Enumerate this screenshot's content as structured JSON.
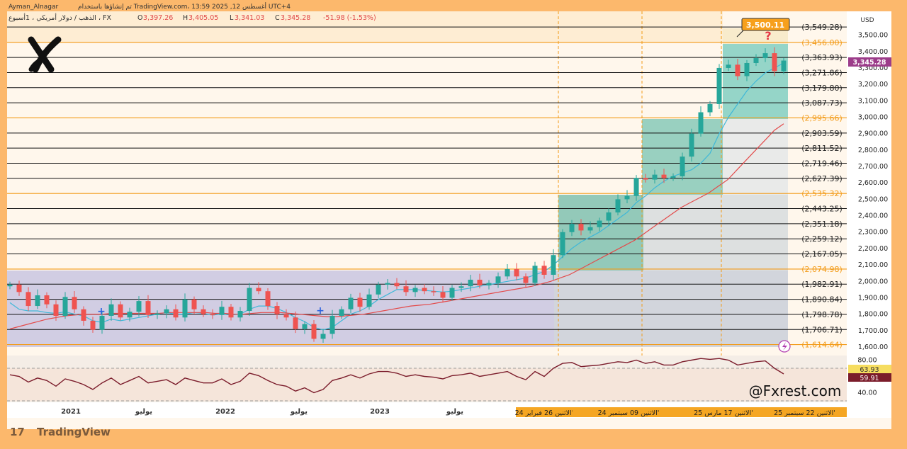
{
  "header": {
    "author": "Ayman_Alnagar",
    "published": "تم إنشاؤها باستخدام TradingView.com، 13:59 2025 ,12 أغسطس UTC+4",
    "symbol": "الذهب / دولار أمريكي ، 1أسبوع ، FX",
    "ohlc": {
      "O": "3,397.26",
      "H": "3,405.05",
      "L": "3,341.03",
      "C": "3,345.28",
      "chg": "-51.98 (-1.53%)"
    }
  },
  "watermark": "@Fxrest.com",
  "footer_brand": "TradingView",
  "currency": "USD",
  "last_price": "3,345.28",
  "callout": {
    "value": "3,500.11",
    "mark": "?"
  },
  "colors": {
    "background": "#fcb86c",
    "up": "#26a69a",
    "down": "#ef5350",
    "ma_fast": "#3fb8d8",
    "ma_slow": "#e34b4b",
    "rsi": "#7b1c2b",
    "fib_orange": "#f39a16",
    "callout": "#f7a01c"
  },
  "chart_data": [
    {
      "type": "line",
      "title": "",
      "ylabel": "USD",
      "ylim": [
        1600,
        3600
      ],
      "y_ticks": [
        "3,500.00",
        "3,400.00",
        "3,300.00",
        "3,200.00",
        "3,100.00",
        "3,000.00",
        "2,900.00",
        "2,800.00",
        "2,700.00",
        "2,600.00",
        "2,500.00",
        "2,400.00",
        "2,300.00",
        "2,200.00",
        "2,100.00",
        "2,000.00",
        "1,900.00",
        "1,800.00",
        "1,700.00",
        "1,600.00"
      ],
      "x_ticks": [
        "2021",
        "يوليو",
        "2022",
        "يوليو",
        "2023",
        "يوليو"
      ],
      "date_labels": [
        "الاثنين 26 فبراير 24'",
        "الاثنين 09 سبتمبر 24'",
        "الاثنين 17 مارس 25'",
        "الاثنين 22 سبتمبر 25'"
      ],
      "grid": false,
      "levels": [
        {
          "label": "(3,549.28)",
          "value": 3549.28,
          "color": "black"
        },
        {
          "label": "(3,456.00)",
          "value": 3456.0,
          "color": "orange"
        },
        {
          "label": "(3,363.93)",
          "value": 3363.93,
          "color": "black"
        },
        {
          "label": "(3,271.86)",
          "value": 3271.86,
          "color": "black"
        },
        {
          "label": "(3,179.80)",
          "value": 3179.8,
          "color": "black"
        },
        {
          "label": "(3,087.73)",
          "value": 3087.73,
          "color": "black"
        },
        {
          "label": "(2,995.66)",
          "value": 2995.66,
          "color": "orange"
        },
        {
          "label": "(2,903.59)",
          "value": 2903.59,
          "color": "black"
        },
        {
          "label": "(2,811.52)",
          "value": 2811.52,
          "color": "black"
        },
        {
          "label": "(2,719.46)",
          "value": 2719.46,
          "color": "black"
        },
        {
          "label": "(2,627.39)",
          "value": 2627.39,
          "color": "black"
        },
        {
          "label": "(2,535.32)",
          "value": 2535.32,
          "color": "orange"
        },
        {
          "label": "(2,443.25)",
          "value": 2443.25,
          "color": "black"
        },
        {
          "label": "(2,351.18)",
          "value": 2351.18,
          "color": "black"
        },
        {
          "label": "(2,259.12)",
          "value": 2259.12,
          "color": "black"
        },
        {
          "label": "(2,167.05)",
          "value": 2167.05,
          "color": "black"
        },
        {
          "label": "(2,074.98)",
          "value": 2074.98,
          "color": "orange"
        },
        {
          "label": "(1,982.91)",
          "value": 1982.91,
          "color": "black"
        },
        {
          "label": "(1,890.84)",
          "value": 1890.84,
          "color": "black"
        },
        {
          "label": "(1,798.78)",
          "value": 1798.78,
          "color": "black"
        },
        {
          "label": "(1,706.71)",
          "value": 1706.71,
          "color": "black"
        },
        {
          "label": "(1,614.64)",
          "value": 1614.64,
          "color": "orange"
        }
      ],
      "series": [
        {
          "values": [
            1980,
            1935,
            1850,
            1915,
            1860,
            1790,
            1905,
            1830,
            1760,
            1705,
            1790,
            1860,
            1780,
            1815,
            1880,
            1795,
            1805,
            1830,
            1780,
            1890,
            1830,
            1800,
            1795,
            1845,
            1780,
            1820,
            1960,
            1940,
            1850,
            1800,
            1780,
            1710,
            1740,
            1650,
            1680,
            1790,
            1830,
            1900,
            1845,
            1920,
            1980,
            1990,
            1970,
            1935,
            1960,
            1940,
            1935,
            1900,
            1960,
            1970,
            2010,
            1975,
            1990,
            2030,
            2075,
            2030,
            1990,
            2095,
            2040,
            2160,
            2300,
            2350,
            2310,
            2330,
            2370,
            2420,
            2500,
            2520,
            2630,
            2620,
            2650,
            2630,
            2640,
            2760,
            2900,
            3030,
            3080,
            3300,
            3320,
            3250,
            3330,
            3360,
            3390,
            3280,
            3345
          ]
        },
        {
          "name": "",
          "values": [
            1870,
            1830,
            1820,
            1820,
            1810,
            1805,
            1815,
            1800,
            1790,
            1760,
            1750,
            1770,
            1760,
            1770,
            1780,
            1790,
            1800,
            1810,
            1800,
            1800,
            1810,
            1805,
            1795,
            1800,
            1795,
            1800,
            1830,
            1850,
            1850,
            1835,
            1810,
            1780,
            1755,
            1720,
            1705,
            1720,
            1760,
            1800,
            1820,
            1850,
            1890,
            1920,
            1950,
            1950,
            1950,
            1945,
            1940,
            1935,
            1940,
            1950,
            1960,
            1970,
            1980,
            1990,
            2000,
            2010,
            2020,
            2040,
            2060,
            2100,
            2150,
            2200,
            2240,
            2270,
            2300,
            2340,
            2380,
            2420,
            2480,
            2520,
            2570,
            2610,
            2640,
            2660,
            2680,
            2720,
            2780,
            2900,
            3000,
            3080,
            3160,
            3220,
            3270,
            3300,
            3330
          ]
        },
        {
          "name": "",
          "values": [
            1710,
            1725,
            1740,
            1755,
            1770,
            1780,
            1790,
            1795,
            1800,
            1800,
            1800,
            1805,
            1805,
            1805,
            1805,
            1805,
            1805,
            1810,
            1810,
            1810,
            1810,
            1810,
            1805,
            1805,
            1800,
            1800,
            1805,
            1810,
            1810,
            1810,
            1805,
            1800,
            1795,
            1790,
            1785,
            1785,
            1790,
            1795,
            1800,
            1810,
            1820,
            1830,
            1840,
            1850,
            1855,
            1860,
            1870,
            1880,
            1890,
            1900,
            1910,
            1920,
            1930,
            1940,
            1950,
            1960,
            1970,
            1985,
            2000,
            2020,
            2040,
            2070,
            2100,
            2130,
            2160,
            2190,
            2220,
            2250,
            2290,
            2330,
            2370,
            2410,
            2450,
            2480,
            2510,
            2540,
            2580,
            2620,
            2680,
            2740,
            2800,
            2860,
            2920,
            2960
          ]
        }
      ]
    },
    {
      "type": "line",
      "title": "",
      "ylim": [
        30,
        85
      ],
      "y_ticks": [
        "80.00",
        "40.00"
      ],
      "overbought": 70,
      "oversold": 30,
      "badges": [
        "63.93",
        "59.91"
      ],
      "series": [
        {
          "values": [
            62,
            60,
            53,
            58,
            55,
            48,
            57,
            54,
            50,
            44,
            52,
            58,
            50,
            55,
            60,
            52,
            54,
            56,
            50,
            58,
            55,
            52,
            52,
            57,
            50,
            54,
            64,
            61,
            55,
            50,
            48,
            42,
            46,
            40,
            44,
            55,
            58,
            62,
            58,
            63,
            66,
            66,
            64,
            60,
            62,
            60,
            59,
            57,
            61,
            62,
            64,
            60,
            62,
            64,
            66,
            60,
            56,
            66,
            60,
            70,
            76,
            77,
            72,
            73,
            74,
            76,
            78,
            77,
            80,
            76,
            78,
            74,
            74,
            78,
            80,
            82,
            81,
            82,
            80,
            74,
            76,
            78,
            79,
            70,
            63
          ]
        }
      ]
    }
  ]
}
